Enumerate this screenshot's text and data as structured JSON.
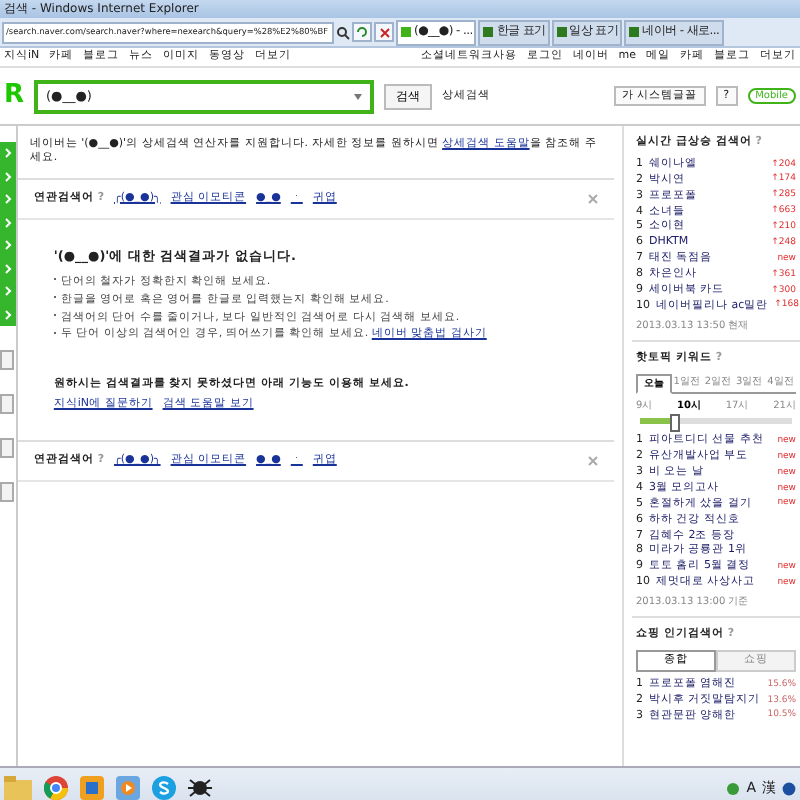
{
  "window": {
    "title": "검색 - Windows Internet Explorer"
  },
  "browser": {
    "address": "/search.naver.com/search.naver?where=nexearch&query=%28%E2%80%BF",
    "tabs": [
      {
        "label": "(●__●) - ...",
        "selected": true
      },
      {
        "label": "한글 표기",
        "selected": false
      },
      {
        "label": "일상 표기",
        "selected": false
      },
      {
        "label": "네이버 - 새로...",
        "selected": false
      }
    ]
  },
  "menu": {
    "left": [
      "지식iN",
      "카페",
      "블로그",
      "뉴스",
      "이미지",
      "동영상",
      "더보기"
    ],
    "right": [
      "소셜네트워크사용",
      "로그인",
      "네이버",
      "me",
      "메일",
      "카페",
      "블로그",
      "더보기"
    ]
  },
  "search": {
    "logo": "R",
    "value": "(●__●)",
    "button": "검색",
    "detail": "상세검색",
    "font_button": "가 시스템글꼴",
    "help": "?",
    "mobile": "Mobile"
  },
  "notice": {
    "before": "네이버는 '(●__●)'의 상세검색 연산자를 지원합니다. 자세한 정보를 원하시면 ",
    "link": "상세검색 도움말",
    "after": "을 참조해 주세요."
  },
  "related": [
    {
      "label": "연관검색어",
      "help": "?",
      "items": [
        "╭(●_●)╮",
        "관심 이모티콘",
        "●_●",
        "ㆍ",
        "귀엽"
      ]
    },
    {
      "label": "연관검색어",
      "help": "?",
      "items": [
        "╭(●_●)╮",
        "관심 이모티콘",
        "●_●",
        "ㆍ",
        "귀엽"
      ]
    }
  ],
  "no_result": {
    "title": "'(●__●)'에 대한 검색결과가 없습니다.",
    "tips": [
      {
        "text": "단어의 철자가 정확한지 확인해 보세요."
      },
      {
        "text": "한글을 영어로 혹은 영어를 한글로 입력했는지 확인해 보세요."
      },
      {
        "text": "검색어의 단어 수를 줄이거나, 보다 일반적인 검색어로 다시 검색해 보세요."
      },
      {
        "text": "두 단어 이상의 검색어인 경우, 띄어쓰기를 확인해 보세요. ",
        "link": "네이버 맞춤법 검사기"
      }
    ]
  },
  "more": {
    "text": "원하시는 검색결과를 찾지 못하셨다면 아래 기능도 이용해 보세요.",
    "links": [
      "지식iN에 질문하기",
      "검색 도움말 보기"
    ]
  },
  "realtime": {
    "title": "실시간 급상승 검색어",
    "help": "?",
    "items": [
      {
        "rank": "1",
        "text": "쉐이나엘",
        "change": "↑204"
      },
      {
        "rank": "2",
        "text": "박시연",
        "change": "↑174"
      },
      {
        "rank": "3",
        "text": "프로포폴",
        "change": "↑285"
      },
      {
        "rank": "4",
        "text": "소녀들",
        "change": "↑663"
      },
      {
        "rank": "5",
        "text": "소이현",
        "change": "↑210"
      },
      {
        "rank": "6",
        "text": "DHKTM",
        "change": "↑248"
      },
      {
        "rank": "7",
        "text": "태진 독점음",
        "change": "new"
      },
      {
        "rank": "8",
        "text": "차은인사",
        "change": "↑361"
      },
      {
        "rank": "9",
        "text": "세이버북 카드",
        "change": "↑300"
      },
      {
        "rank": "10",
        "text": "네이버필리나 ac밀란",
        "change": "↑168"
      }
    ],
    "timestamp": "2013.03.13 13:50 현재"
  },
  "hot": {
    "title": "핫토픽 키워드",
    "help": "?",
    "days": [
      {
        "label": "오늘",
        "selected": true
      },
      {
        "label": "1일전",
        "selected": false
      },
      {
        "label": "2일전",
        "selected": false
      },
      {
        "label": "3일전",
        "selected": false
      },
      {
        "label": "4일전",
        "selected": false
      }
    ],
    "hours": [
      {
        "label": "9시",
        "selected": false
      },
      {
        "label": "10시",
        "selected": true
      },
      {
        "label": "17시",
        "selected": false
      },
      {
        "label": "21시",
        "selected": false
      }
    ],
    "level": 0.22,
    "items": [
      {
        "rank": "1",
        "text": "피아트디디 선물 추천",
        "badge": "new"
      },
      {
        "rank": "2",
        "text": "유산개발사업 부도",
        "badge": "new"
      },
      {
        "rank": "3",
        "text": "비 오는 날",
        "badge": "new"
      },
      {
        "rank": "4",
        "text": "3월 모의고사",
        "badge": "new"
      },
      {
        "rank": "5",
        "text": "혼절하게 샀을 걸기",
        "badge": "new"
      },
      {
        "rank": "6",
        "text": "하하 건강 적신호"
      },
      {
        "rank": "7",
        "text": "김혜수 2조 등장"
      },
      {
        "rank": "8",
        "text": "미라가 공룡관 1위"
      },
      {
        "rank": "9",
        "text": "토토 홈리 5월 결정",
        "badge": "new"
      },
      {
        "rank": "10",
        "text": "제멋대로 사상사고",
        "badge": "new"
      }
    ],
    "timestamp": "2013.03.13 13:00 기준"
  },
  "shopping": {
    "title": "쇼핑 인기검색어",
    "help": "?",
    "tabs": [
      {
        "label": "종합",
        "selected": true
      },
      {
        "label": "쇼핑",
        "selected": false
      }
    ],
    "items": [
      {
        "rank": "1",
        "text": "프로포폴 염해진",
        "share": "15.6%"
      },
      {
        "rank": "2",
        "text": "박시후 거짓말탐지기",
        "share": "13.6%"
      },
      {
        "rank": "3",
        "text": "현관문판 양해한",
        "share": "10.5%"
      }
    ]
  },
  "tray": [
    "A",
    "漢"
  ]
}
